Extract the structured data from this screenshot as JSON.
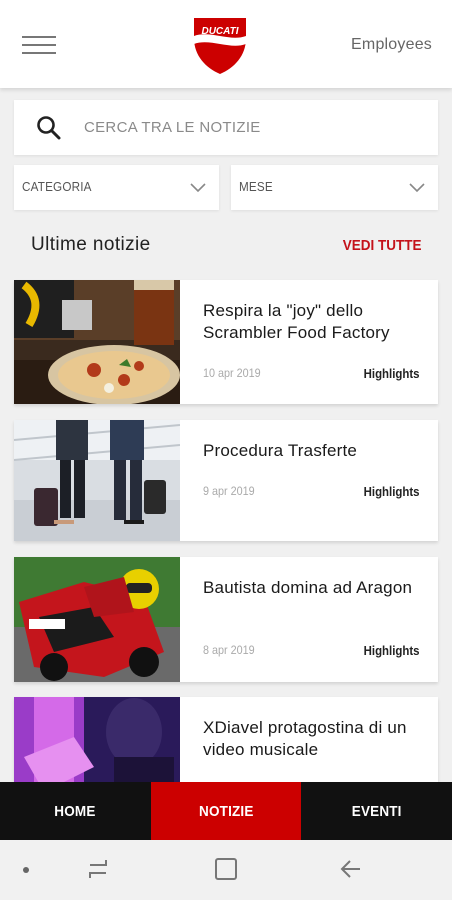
{
  "header": {
    "logo_text": "DUCATI",
    "employees_label": "Employees"
  },
  "search": {
    "placeholder": "CERCA TRA LE NOTIZIE"
  },
  "filters": {
    "category_label": "CATEGORIA",
    "month_label": "MESE"
  },
  "section": {
    "title": "Ultime notizie",
    "see_all": "VEDI TUTTE"
  },
  "news": [
    {
      "title": "Respira la \"joy\" dello Scrambler Food Factory",
      "date": "10 apr 2019",
      "tag": "Highlights"
    },
    {
      "title": "Procedura Trasferte",
      "date": "9 apr 2019",
      "tag": "Highlights"
    },
    {
      "title": "Bautista domina ad Aragon",
      "date": "8 apr 2019",
      "tag": "Highlights"
    },
    {
      "title": "XDiavel protagostina di un video musicale",
      "date": "",
      "tag": ""
    }
  ],
  "bottom_nav": {
    "tabs": [
      "HOME",
      "NOTIZIE",
      "EVENTI"
    ],
    "active": "NOTIZIE"
  },
  "colors": {
    "brand_red": "#cc0000",
    "nav_dark": "#111111",
    "see_all_red": "#c4121a"
  },
  "icons": [
    "menu-icon",
    "ducati-logo",
    "search-icon",
    "chevron-down-icon",
    "recent-apps-icon",
    "home-icon",
    "back-icon"
  ]
}
